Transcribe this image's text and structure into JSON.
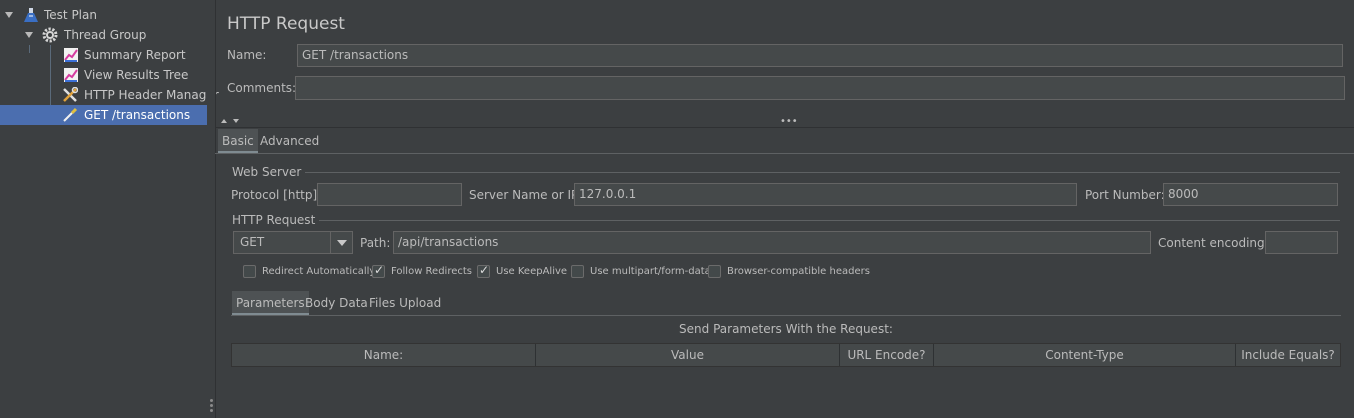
{
  "tree": {
    "items": [
      {
        "label": "Test Plan",
        "icon": "flask-icon",
        "expanded": true
      },
      {
        "label": "Thread Group",
        "icon": "gear-icon",
        "expanded": true
      },
      {
        "label": "Summary Report",
        "icon": "chart-icon"
      },
      {
        "label": "View Results Tree",
        "icon": "chart-icon"
      },
      {
        "label": "HTTP Header Manager",
        "icon": "tools-icon"
      },
      {
        "label": "GET /transactions",
        "icon": "pipette-icon",
        "selected": true
      }
    ]
  },
  "panel": {
    "title": "HTTP Request",
    "name_label": "Name:",
    "name_value": "GET /transactions",
    "comments_label": "Comments:",
    "comments_value": ""
  },
  "tabs": {
    "basic": "Basic",
    "advanced": "Advanced"
  },
  "web_server": {
    "section_label": "Web Server",
    "protocol_label": "Protocol [http]:",
    "protocol_value": "",
    "server_label": "Server Name or IP:",
    "server_value": "127.0.0.1",
    "port_label": "Port Number:",
    "port_value": "8000"
  },
  "http_request": {
    "section_label": "HTTP Request",
    "method": "GET",
    "path_label": "Path:",
    "path_value": "/api/transactions",
    "encoding_label": "Content encoding:",
    "encoding_value": ""
  },
  "options": [
    {
      "label": "Redirect Automatically",
      "checked": false
    },
    {
      "label": "Follow Redirects",
      "checked": true
    },
    {
      "label": "Use KeepAlive",
      "checked": true
    },
    {
      "label": "Use multipart/form-data",
      "checked": false
    },
    {
      "label": "Browser-compatible headers",
      "checked": false
    }
  ],
  "sub_tabs": {
    "parameters": "Parameters",
    "body_data": "Body Data",
    "files_upload": "Files Upload"
  },
  "params": {
    "caption": "Send Parameters With the Request:",
    "columns": [
      "Name:",
      "Value",
      "URL Encode?",
      "Content-Type",
      "Include Equals?"
    ]
  },
  "colors": {
    "background": "#3c3f41",
    "selection": "#4b6eaf",
    "field": "#45494a"
  }
}
